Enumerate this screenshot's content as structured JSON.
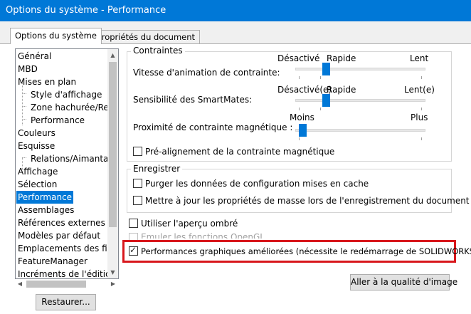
{
  "window": {
    "title": "Options du système - Performance"
  },
  "tabs": [
    {
      "label": "Options du système",
      "active": true
    },
    {
      "label": "Propriétés du document",
      "active": false
    }
  ],
  "tree": {
    "items": [
      {
        "label": "Général",
        "indent": 0,
        "selected": false
      },
      {
        "label": "MBD",
        "indent": 0,
        "selected": false
      },
      {
        "label": "Mises en plan",
        "indent": 0,
        "selected": false
      },
      {
        "label": "Style d'affichage",
        "indent": 1,
        "selected": false
      },
      {
        "label": "Zone hachurée/Remp",
        "indent": 1,
        "selected": false
      },
      {
        "label": "Performance",
        "indent": 1,
        "selected": false
      },
      {
        "label": "Couleurs",
        "indent": 0,
        "selected": false
      },
      {
        "label": "Esquisse",
        "indent": 0,
        "selected": false
      },
      {
        "label": "Relations/Aimantatio",
        "indent": 1,
        "selected": false
      },
      {
        "label": "Affichage",
        "indent": 0,
        "selected": false
      },
      {
        "label": "Sélection",
        "indent": 0,
        "selected": false
      },
      {
        "label": "Performance",
        "indent": 0,
        "selected": true
      },
      {
        "label": "Assemblages",
        "indent": 0,
        "selected": false
      },
      {
        "label": "Références externes",
        "indent": 0,
        "selected": false
      },
      {
        "label": "Modèles par défaut",
        "indent": 0,
        "selected": false
      },
      {
        "label": "Emplacements des fichi",
        "indent": 0,
        "selected": false
      },
      {
        "label": "FeatureManager",
        "indent": 0,
        "selected": false
      },
      {
        "label": "Incréments de l'édition",
        "indent": 0,
        "selected": false
      }
    ]
  },
  "buttons": {
    "restore": "Restaurer...",
    "image_quality": "Aller à la qualité d'image"
  },
  "constraints_group": {
    "title": "Contraintes",
    "sliders": [
      {
        "label": "Vitesse d'animation de contrainte:",
        "left_label": "Désactivé",
        "mid_label": "Rapide",
        "right_label": "Lent",
        "value": 0.2
      },
      {
        "label": "Sensibilité des SmartMates:",
        "left_label": "Désactivé(e)",
        "mid_label": "Rapide",
        "right_label": "Lent(e)",
        "value": 0.2
      },
      {
        "label": "Proximité de contrainte magnétique :",
        "left_label": "Moins",
        "mid_label": "",
        "right_label": "Plus",
        "value": 0.0
      }
    ],
    "prealign": {
      "label": "Pré-alignement de la contrainte magnétique",
      "checked": false
    }
  },
  "save_group": {
    "title": "Enregistrer",
    "items": [
      {
        "label": "Purger les données de configuration mises en cache",
        "checked": false
      },
      {
        "label": "Mettre à jour les propriétés de masse lors de l'enregistrement du document",
        "checked": false
      }
    ]
  },
  "options": {
    "shaded_preview": {
      "label": "Utiliser l'aperçu ombré",
      "checked": false
    },
    "opengl": {
      "label": "Emuler les fonctions OpenGL",
      "checked": false,
      "disabled": true
    },
    "enhanced_graphics": {
      "label": "Performances graphiques améliorées (nécessite le redémarrage de SOLIDWORKS)",
      "checked": true
    }
  },
  "colors": {
    "accent": "#0078d7",
    "highlight_box": "#d8171c"
  }
}
